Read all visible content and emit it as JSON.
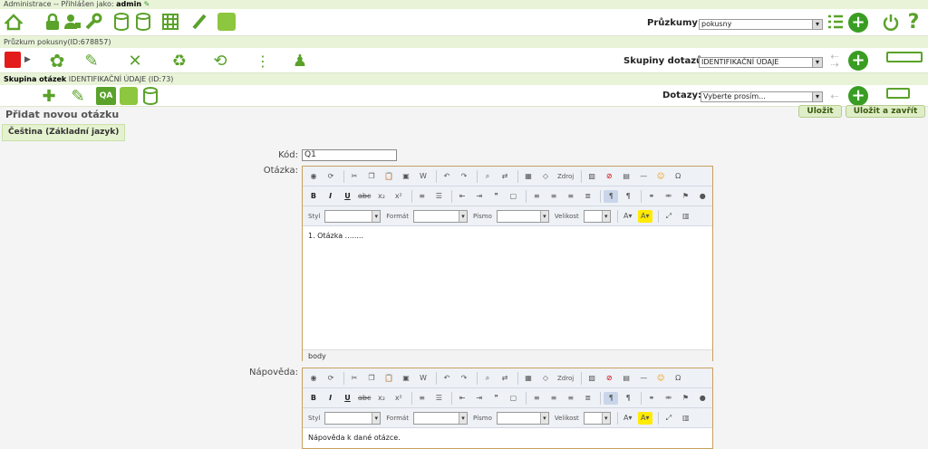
{
  "admin_bar": {
    "prefix": "Administrace -- Přihlášen jako:",
    "user": "admin"
  },
  "top": {
    "surveys_label": "Průzkumy:",
    "survey_value": "pokusny"
  },
  "survey_bar": {
    "text": "Průzkum pokusny(ID:678857)"
  },
  "mid": {
    "groups_label": "Skupiny dotazů:",
    "group_value": "IDENTIFIKAČNÍ ÚDAJE"
  },
  "group_bar": {
    "prefix": "Skupina otázek",
    "text": "IDENTIFIKAČNÍ ÚDAJE (ID:73)"
  },
  "third": {
    "questions_label": "Dotazy:",
    "question_value": "Vyberte prosím..."
  },
  "page": {
    "title": "Přidat novou otázku",
    "save": "Uložit",
    "save_close": "Uložit a zavřít",
    "tab": "Čeština (Základní jazyk)"
  },
  "form": {
    "code_label": "Kód:",
    "code_value": "Q1",
    "question_label": "Otázka:",
    "help_label": "Nápověda:"
  },
  "editor": {
    "source": "Zdroj",
    "style": "Styl",
    "format": "Formát",
    "font": "Písmo",
    "size": "Velikost",
    "status": "body",
    "question_content": "1. Otázka ........",
    "help_content": "Nápověda k dané otázce."
  },
  "colors": {
    "green": "#8dc63f",
    "dark_green": "#3a9d23",
    "red": "#e31b1b"
  }
}
